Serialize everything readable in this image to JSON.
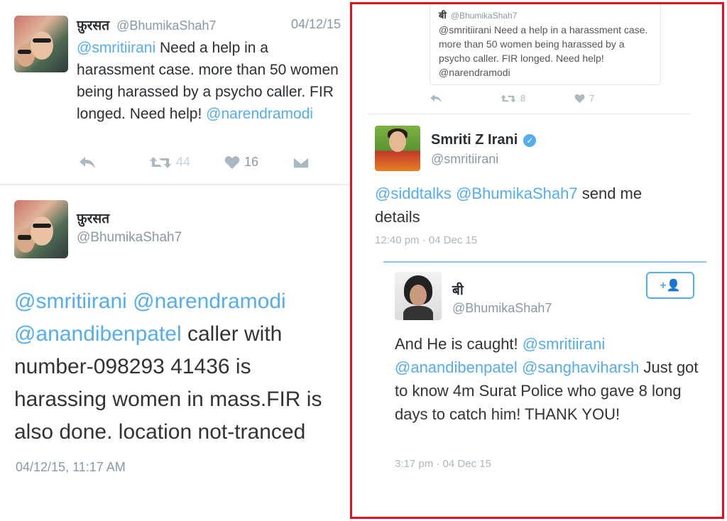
{
  "tweet1": {
    "name": "फ़ुरसत",
    "handle": "@BhumikaShah7",
    "date": "04/12/15",
    "text_parts": [
      {
        "t": "@smritiirani",
        "m": true
      },
      {
        "t": " Need a help in a harassment case. more than 50 women being harassed by a psycho caller. FIR longed. Need help! ",
        "m": false
      },
      {
        "t": "@narendramodi",
        "m": true
      }
    ],
    "retweets": "44",
    "likes": "16"
  },
  "tweet2": {
    "name": "फ़ुरसत",
    "handle": "@BhumikaShah7",
    "text_parts": [
      {
        "t": "@smritiirani",
        "m": true
      },
      {
        "t": " ",
        "m": false
      },
      {
        "t": "@narendramodi",
        "m": true
      },
      {
        "t": " ",
        "m": false
      },
      {
        "t": "@anandibenpatel",
        "m": true
      },
      {
        "t": " caller with number-098293 41436 is harassing women in mass.FIR is also done. location not-tranced",
        "m": false
      }
    ],
    "timestamp": "04/12/15, 11:17 AM"
  },
  "quoted": {
    "name": "बी",
    "handle": "@BhumikaShah7",
    "text_parts": [
      {
        "t": "@smritiirani",
        "m": false
      },
      {
        "t": " Need a help in a harassment case. more than 50 women being harassed by a psycho caller. FIR longed. Need help! ",
        "m": false
      },
      {
        "t": "@narendramodi",
        "m": false
      }
    ],
    "retweets": "8",
    "likes": "7"
  },
  "reply1": {
    "name": "Smriti Z Irani",
    "handle": "@smritiirani",
    "text_parts": [
      {
        "t": "@siddtalks",
        "m": true
      },
      {
        "t": " ",
        "m": false
      },
      {
        "t": "@BhumikaShah7",
        "m": true
      },
      {
        "t": " send me details",
        "m": false
      }
    ],
    "timestamp": "12:40 pm · 04 Dec 15"
  },
  "reply2": {
    "name": "बी",
    "handle": "@BhumikaShah7",
    "follow_label": "+👤",
    "text_parts": [
      {
        "t": "And He is caught! ",
        "m": false
      },
      {
        "t": "@smritiirani",
        "m": true
      },
      {
        "t": " ",
        "m": false
      },
      {
        "t": "@anandibenpatel",
        "m": true
      },
      {
        "t": " ",
        "m": false
      },
      {
        "t": "@sanghaviharsh",
        "m": true
      },
      {
        "t": " Just got to know 4m Surat Police who gave 8 long days to catch him! THANK YOU!",
        "m": false
      }
    ],
    "timestamp": "3:17 pm · 04 Dec 15"
  },
  "icons": {
    "reply": "reply-icon",
    "retweet": "retweet-icon",
    "like": "heart-icon",
    "dm": "envelope-icon",
    "verified": "verified-badge-icon",
    "follow": "add-user-icon"
  },
  "colors": {
    "mention": "#55acee",
    "muted": "#8899a6",
    "text": "#292f33",
    "highlight_box": "#e0141e"
  }
}
